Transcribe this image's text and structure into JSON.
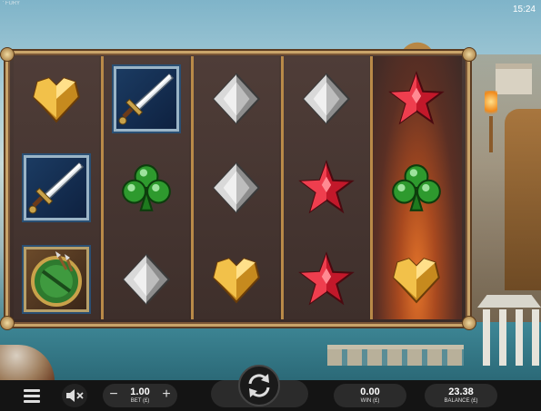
{
  "header": {
    "game_title": "' FURY",
    "clock": "15:24"
  },
  "reels": [
    [
      "gold-heart",
      "sword",
      "shield"
    ],
    [
      "sword",
      "green-club",
      "silver-diamond"
    ],
    [
      "silver-diamond",
      "silver-diamond",
      "gold-heart"
    ],
    [
      "silver-diamond",
      "red-star",
      "red-star"
    ],
    [
      "red-star",
      "green-club",
      "gold-heart"
    ]
  ],
  "controls": {
    "menu_icon": "hamburger-icon",
    "sound_icon": "speaker-muted-icon",
    "bet_value": "1.00",
    "bet_label": "BET (£)",
    "bet_minus": "−",
    "bet_plus": "+",
    "spin_icon": "spin-arrows-icon",
    "win_value": "0.00",
    "win_label": "WIN (£)",
    "balance_value": "23.38",
    "balance_label": "BALANCE (£)"
  },
  "colors": {
    "frame_gold": "#c9a46a",
    "reel_bg": "#3e2f2b",
    "bar_bg": "#141414"
  }
}
